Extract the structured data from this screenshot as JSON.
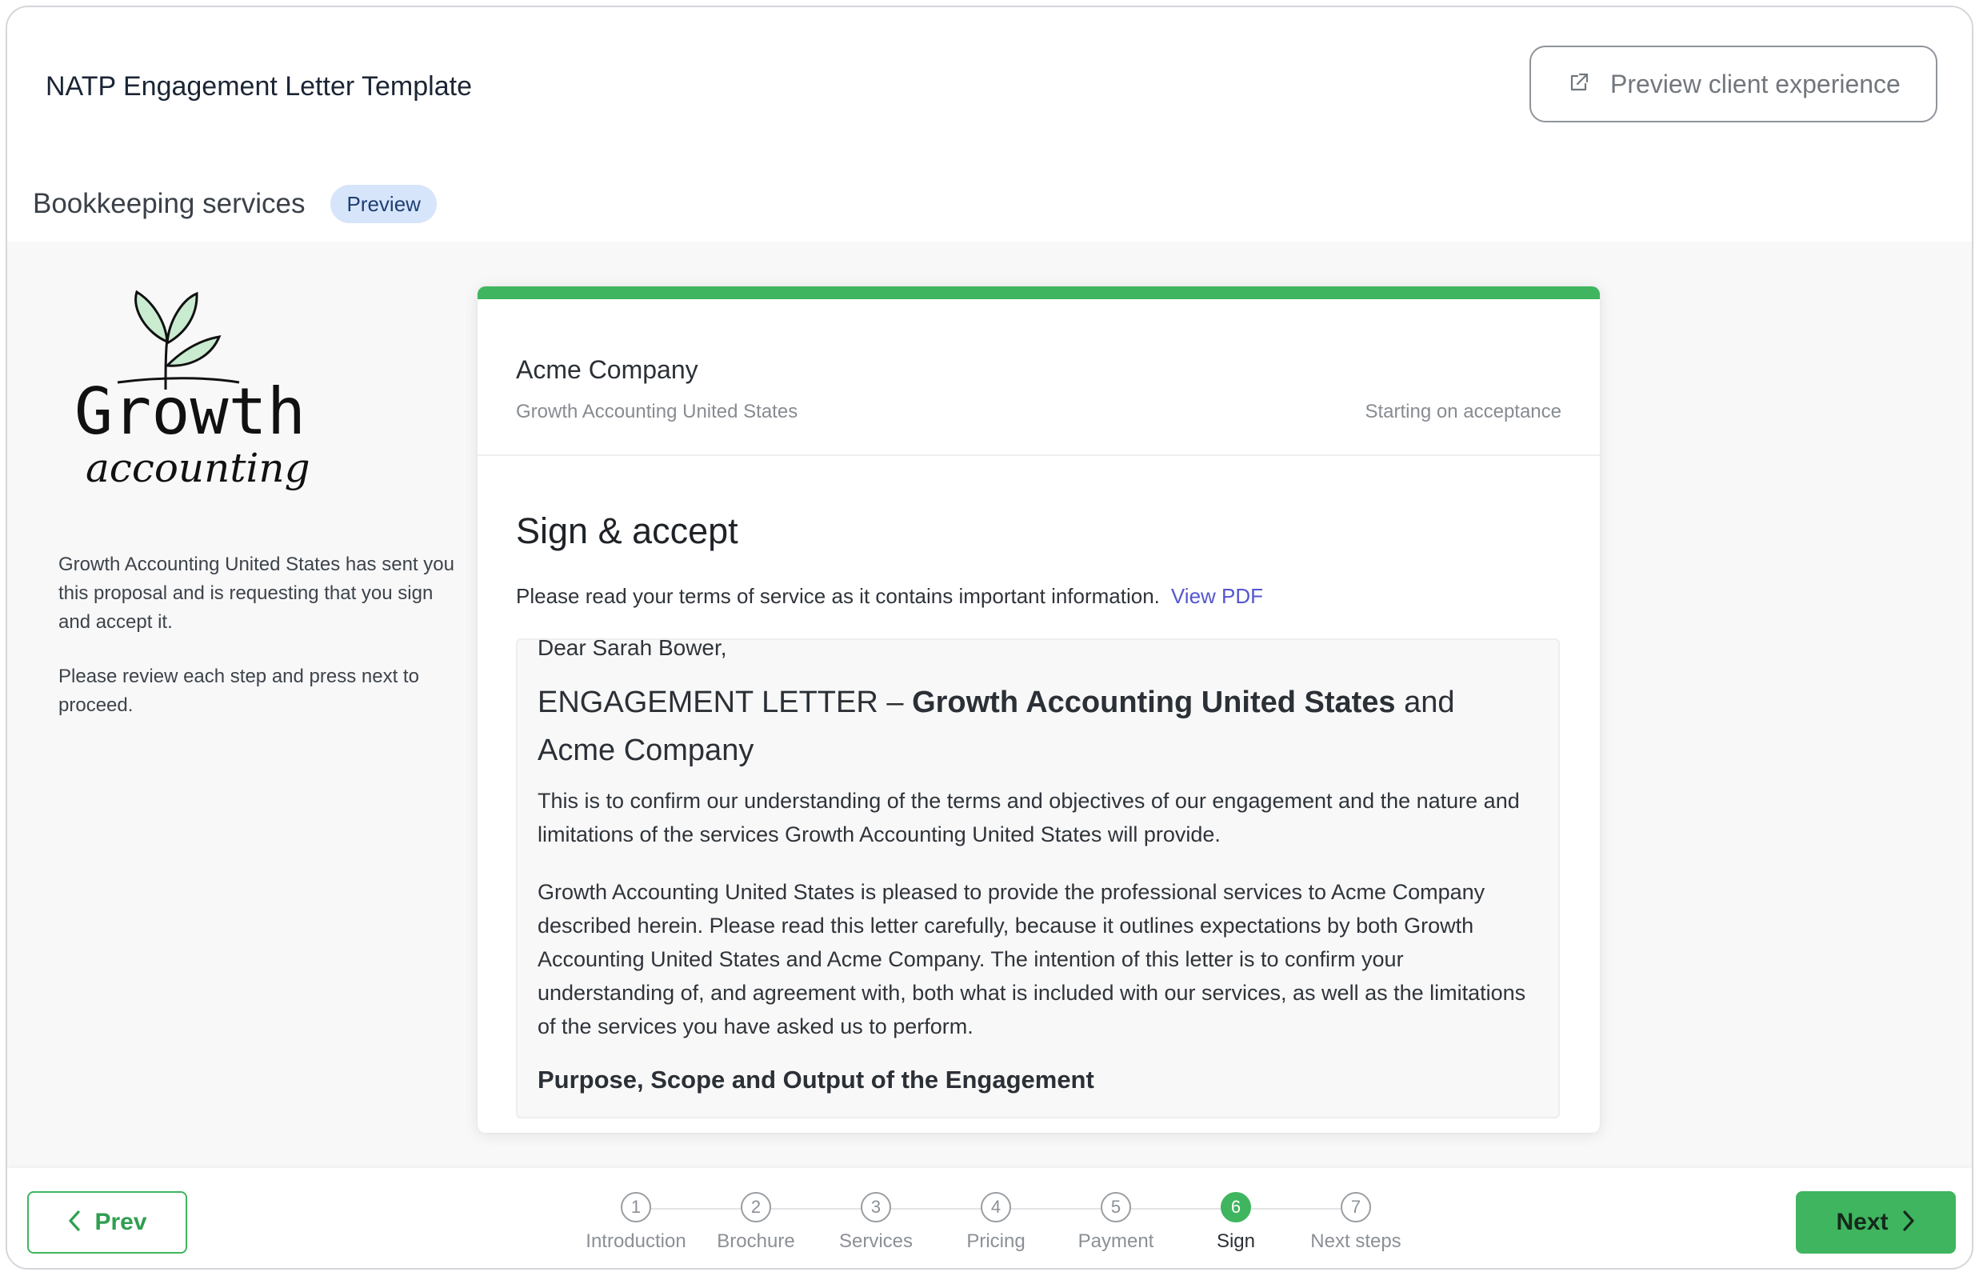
{
  "header": {
    "title": "NATP Engagement Letter Template",
    "preview_button": "Preview client experience",
    "subtitle": "Bookkeeping services",
    "badge": "Preview"
  },
  "sidebar": {
    "logo_text": "Growth",
    "logo_script": "accounting",
    "message_1": "Growth Accounting United States has sent you this proposal and is requesting that you sign and accept it.",
    "message_2": "Please review each step and press next to proceed."
  },
  "card": {
    "company": "Acme Company",
    "firm": "Growth Accounting United States",
    "start": "Starting on acceptance",
    "section_title": "Sign & accept",
    "instruction": "Please read your terms of service as it contains important information.",
    "view_pdf": "View PDF",
    "accent_color": "#3fb55f"
  },
  "letter": {
    "greeting": "Dear Sarah Bower,",
    "heading_prefix": "ENGAGEMENT LETTER – ",
    "heading_bold": "Growth Accounting United States",
    "heading_suffix": " and Acme Company",
    "para_1": "This is to confirm our understanding of the terms and objectives of our engagement and the nature and limitations of the services Growth Accounting United States will provide.",
    "para_2": "Growth Accounting United States is pleased to provide the professional services to Acme Company described herein. Please read this letter carefully, because it outlines expectations by both Growth Accounting United States and Acme Company. The intention of this letter is to confirm your understanding of, and agreement with, both what is included with our services, as well as the limitations of the services you have asked us to perform.",
    "section_heading": "Purpose, Scope and Output of the Engagement"
  },
  "footer": {
    "prev": "Prev",
    "next": "Next",
    "active_step": 6,
    "steps": [
      {
        "num": "1",
        "label": "Introduction"
      },
      {
        "num": "2",
        "label": "Brochure"
      },
      {
        "num": "3",
        "label": "Services"
      },
      {
        "num": "4",
        "label": "Pricing"
      },
      {
        "num": "5",
        "label": "Payment"
      },
      {
        "num": "6",
        "label": "Sign"
      },
      {
        "num": "7",
        "label": "Next steps"
      }
    ]
  }
}
